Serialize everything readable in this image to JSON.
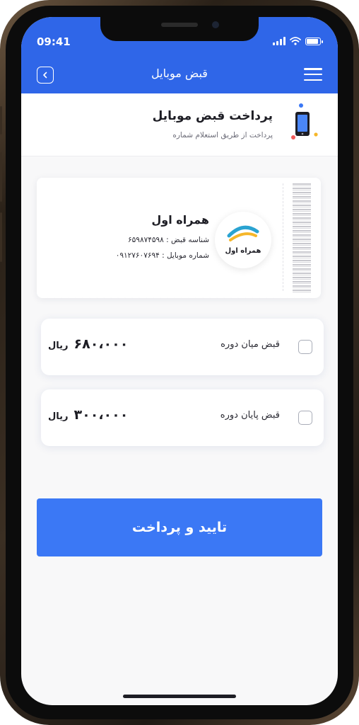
{
  "status_bar": {
    "time": "09:41"
  },
  "header": {
    "title": "قبض موبایل",
    "back_icon": "chevron-left-icon",
    "menu_icon": "hamburger-menu-icon"
  },
  "service": {
    "title": "پرداخت قبض موبایل",
    "subtitle": "پرداخت  از طریق استعلام شماره",
    "icon": "mobile-phone-icon"
  },
  "bill": {
    "operator": "همراه اول",
    "bill_id_line": "شناسه قبض : ۶۵۹۸۷۴۵۹۸",
    "mobile_line": "شماره موبایل : ۰۹۱۲۷۶۰۷۶۹۴",
    "logo_text": "همراه اول",
    "logo_icon": "mci-logo-icon"
  },
  "options": [
    {
      "label": "قبض میان دوره",
      "amount": "۶۸۰،۰۰۰",
      "currency": "ریال",
      "checked": false
    },
    {
      "label": "قبض پایان دوره",
      "amount": "۳۰۰،۰۰۰",
      "currency": "ریال",
      "checked": false
    }
  ],
  "confirm": {
    "label": "تایید و پرداخت"
  },
  "colors": {
    "primary": "#2f66e8",
    "button": "#3b78f5",
    "text": "#1d1d24"
  }
}
